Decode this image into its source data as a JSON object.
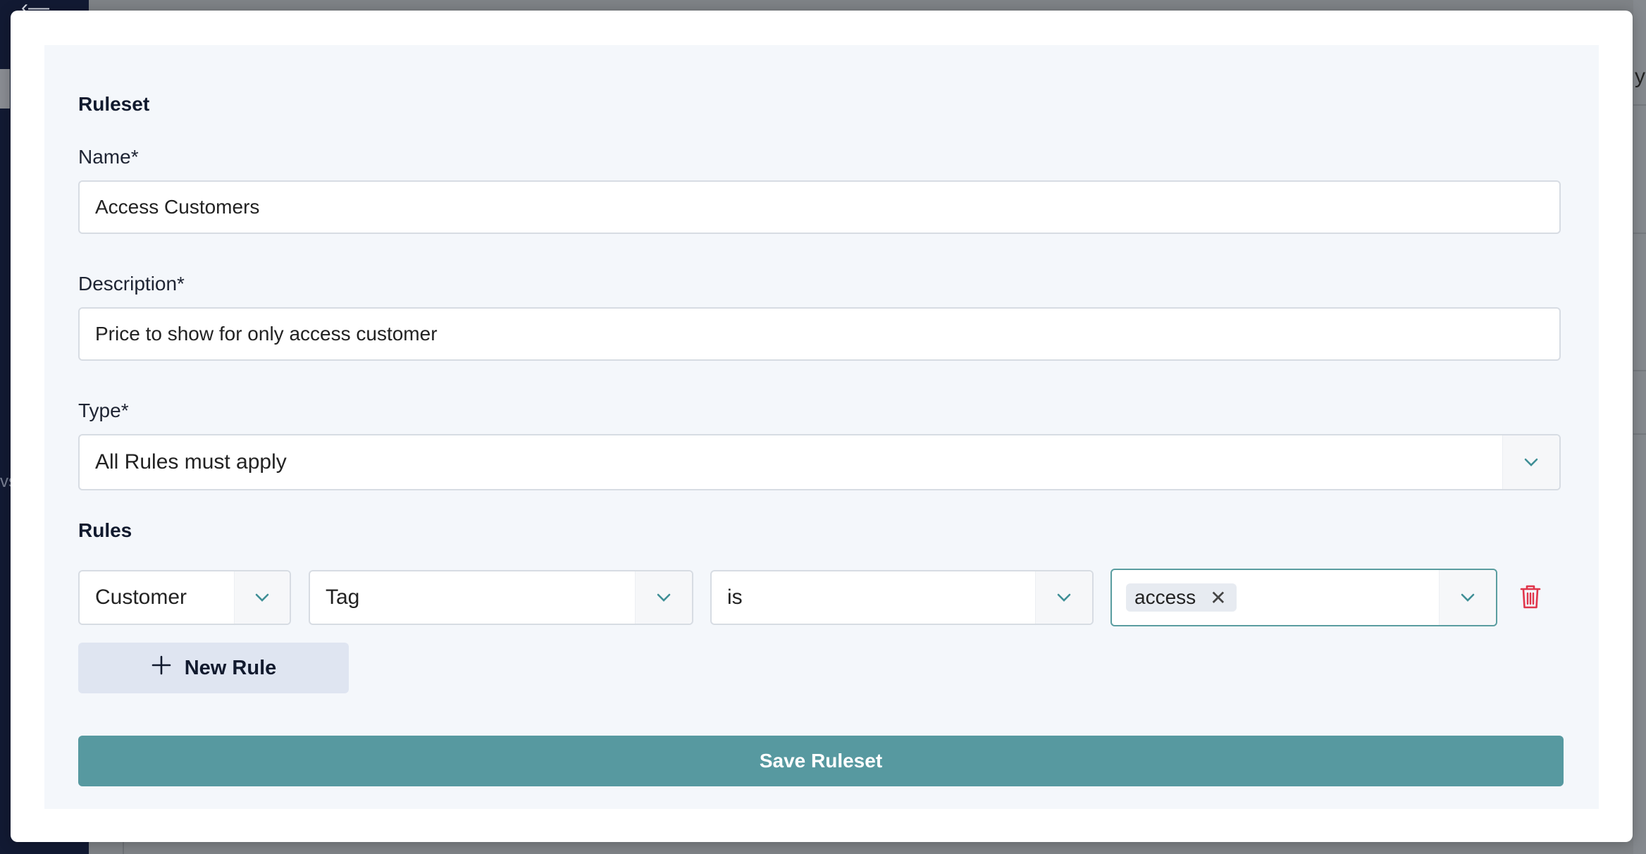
{
  "background": {
    "sidebar_fragment": "vs",
    "right_fragment": "y"
  },
  "ruleset": {
    "section_title": "Ruleset",
    "name": {
      "label": "Name*",
      "value": "Access Customers"
    },
    "description": {
      "label": "Description*",
      "value": "Price to show for only access customer"
    },
    "type": {
      "label": "Type*",
      "value": "All Rules must apply"
    }
  },
  "rules": {
    "section_title": "Rules",
    "items": [
      {
        "field": "Customer",
        "attribute": "Tag",
        "operator": "is",
        "values": [
          "access"
        ],
        "remove_glyph": "✕"
      }
    ],
    "new_rule_label": "New Rule"
  },
  "save_label": "Save Ruleset",
  "colors": {
    "accent": "#5799a0",
    "active_border": "#5a9da0",
    "delete": "#e0364b",
    "card_bg": "#f4f7fb",
    "new_rule_bg": "#dfe5f1"
  },
  "icons": {
    "chevron": "chevron-down-icon",
    "trash": "trash-icon",
    "plus": "plus-icon",
    "remove": "close-icon"
  }
}
